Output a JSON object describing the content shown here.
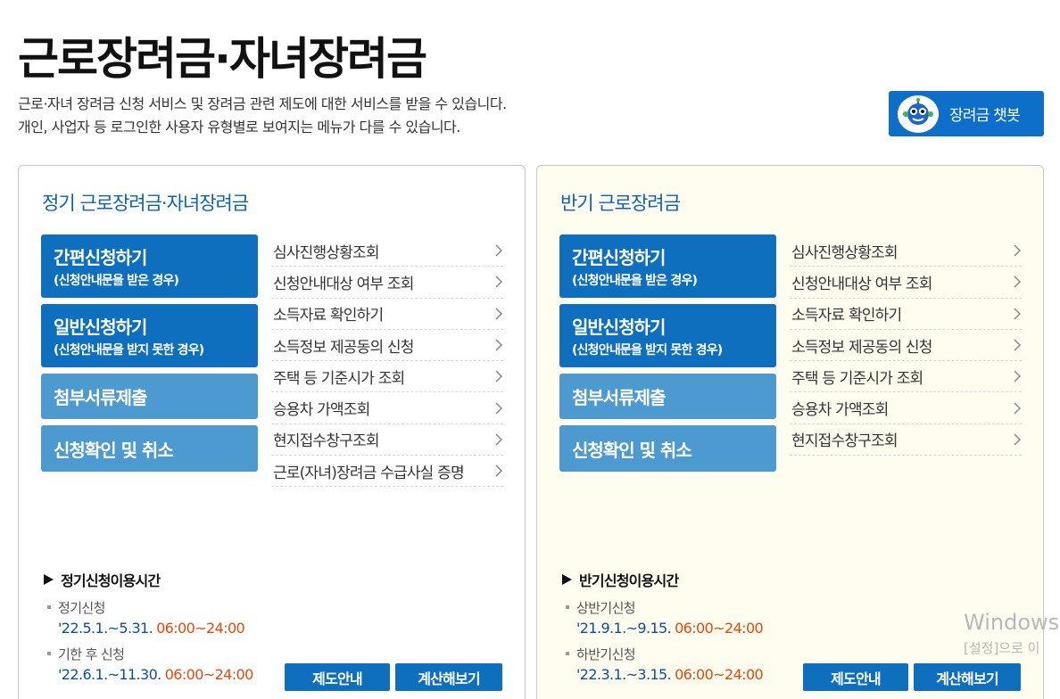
{
  "header": {
    "title": "근로장려금·자녀장려금",
    "desc_line1": "근로·자녀 장려금 신청 서비스 및 장려금 관련 제도에 대한 서비스를 받을 수 있습니다.",
    "desc_line2": "개인, 사업자 등 로그인한 사용자 유형별로 보여지는 메뉴가 다를 수 있습니다.",
    "chatbot_label": "장려금 챗봇"
  },
  "left_panel": {
    "title": "정기 근로장려금·자녀장려금",
    "buttons": [
      {
        "main": "간편신청하기",
        "sub": "(신청안내문을 받은 경우)"
      },
      {
        "main": "일반신청하기",
        "sub": "(신청안내문을 받지 못한 경우)"
      },
      {
        "main": "첨부서류제출"
      },
      {
        "main": "신청확인 및 취소"
      }
    ],
    "links": [
      "심사진행상황조회",
      "신청안내대상 여부 조회",
      "소득자료 확인하기",
      "소득정보 제공동의 신청",
      "주택 등 기준시가 조회",
      "승용차 가액조회",
      "현지접수창구조회",
      "근로(자녀)장려금 수급사실 증명"
    ],
    "time_title": "정기신청이용시간",
    "times": [
      {
        "label": "정기신청",
        "date": "'22.5.1.~5.31.",
        "hours": "06:00~24:00"
      },
      {
        "label": "기한 후 신청",
        "date": "'22.6.1.~11.30.",
        "hours": "06:00~24:00"
      }
    ],
    "btn_info": "제도안내",
    "btn_calc": "계산해보기"
  },
  "right_panel": {
    "title": "반기 근로장려금",
    "buttons": [
      {
        "main": "간편신청하기",
        "sub": "(신청안내문을 받은 경우)"
      },
      {
        "main": "일반신청하기",
        "sub": "(신청안내문을 받지 못한 경우)"
      },
      {
        "main": "첨부서류제출"
      },
      {
        "main": "신청확인 및 취소"
      }
    ],
    "links": [
      "심사진행상황조회",
      "신청안내대상 여부 조회",
      "소득자료 확인하기",
      "소득정보 제공동의 신청",
      "주택 등 기준시가 조회",
      "승용차 가액조회",
      "현지접수창구조회"
    ],
    "time_title": "반기신청이용시간",
    "times": [
      {
        "label": "상반기신청",
        "date": "'21.9.1.~9.15.",
        "hours": "06:00~24:00"
      },
      {
        "label": "하반기신청",
        "date": "'22.3.1.~3.15.",
        "hours": "06:00~24:00"
      }
    ],
    "btn_info": "제도안내",
    "btn_calc": "계산해보기"
  },
  "watermark": {
    "line1": "Windows",
    "line2": "[설정]으로 이"
  },
  "colors": {
    "primary_blue": "#0d6fbe",
    "light_blue": "#4c9ad0",
    "title_blue": "#0d63b0",
    "hours_orange": "#e24a0b",
    "right_panel_bg": "#fefdf0"
  }
}
